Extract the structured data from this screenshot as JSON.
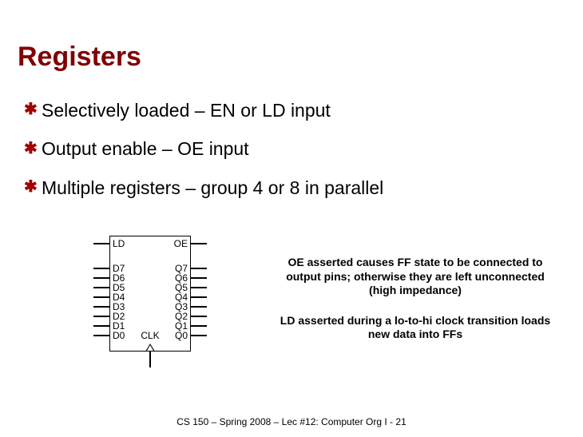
{
  "title": "Registers",
  "bullets": [
    "Selectively loaded – EN or LD input",
    "Output enable – OE input",
    "Multiple registers – group 4 or 8 in parallel"
  ],
  "diagram": {
    "top_left": "LD",
    "top_right": "OE",
    "clk": "CLK",
    "left_pins": [
      "D7",
      "D6",
      "D5",
      "D4",
      "D3",
      "D2",
      "D1",
      "D0"
    ],
    "right_pins": [
      "Q7",
      "Q6",
      "Q5",
      "Q4",
      "Q3",
      "Q2",
      "Q1",
      "Q0"
    ]
  },
  "notes": {
    "oe": "OE asserted causes FF state to be connected to output pins; otherwise they are left unconnected (high impedance)",
    "ld": "LD asserted during a lo-to-hi clock transition loads new data into FFs"
  },
  "footer": "CS 150 – Spring 2008 – Lec #12: Computer Org I - 21"
}
